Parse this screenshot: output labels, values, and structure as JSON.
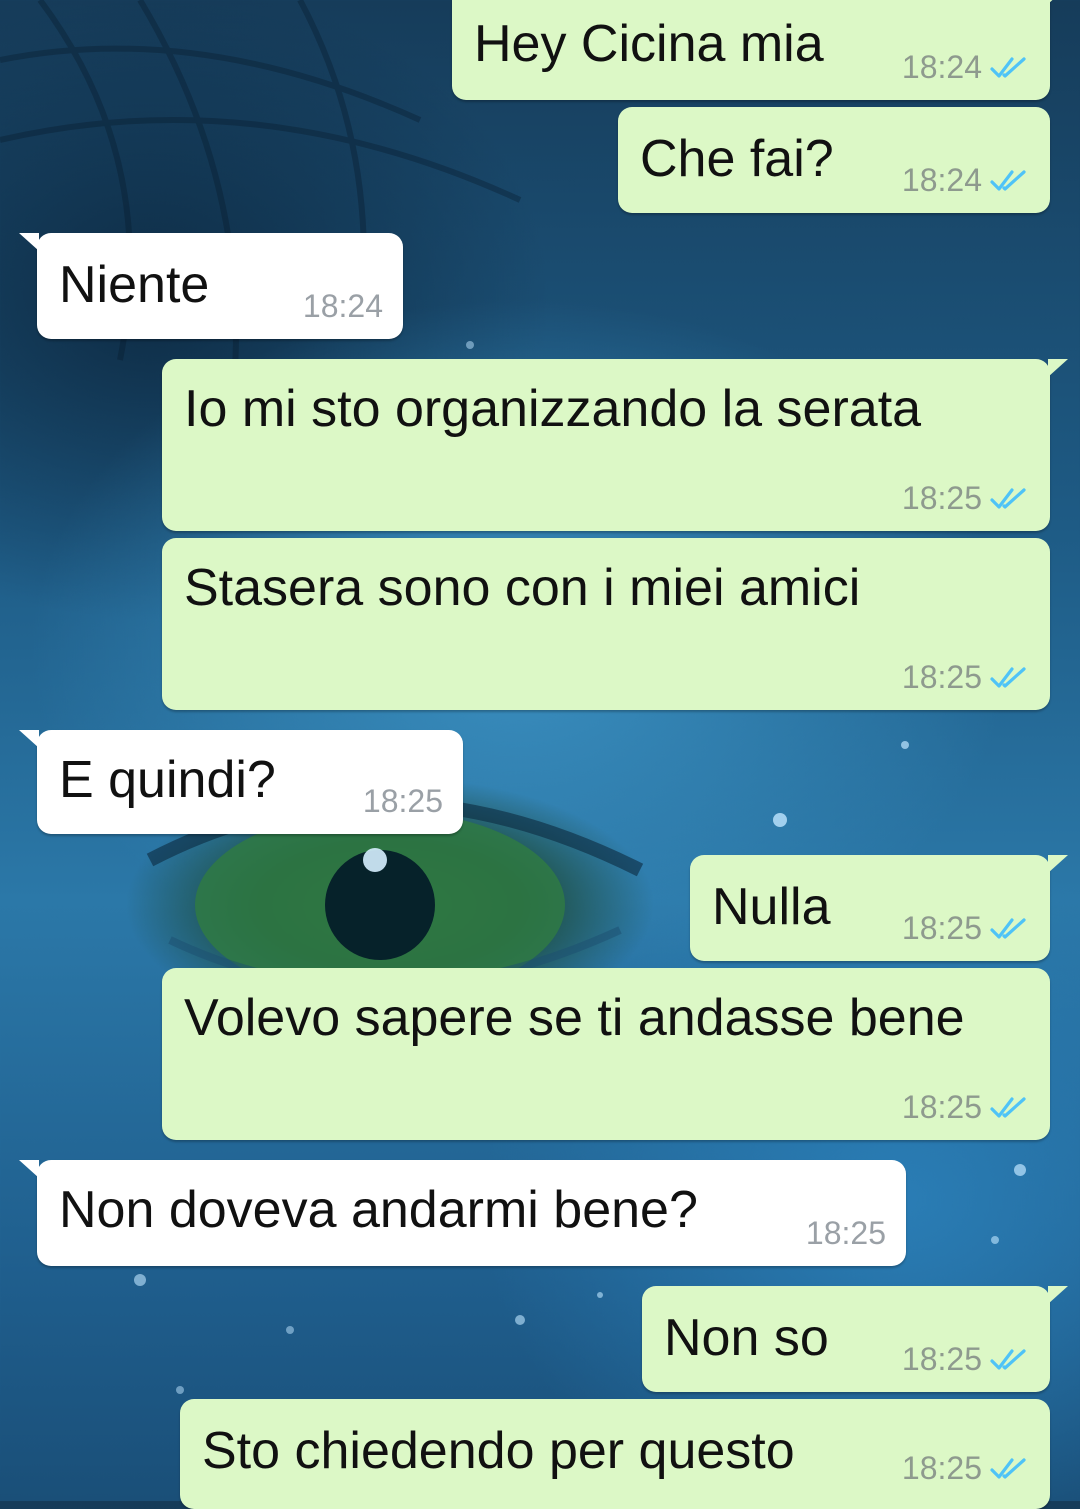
{
  "colors": {
    "outgoing_bubble": "#dcf8c6",
    "incoming_bubble": "#ffffff",
    "read_ticks": "#4fc3f7",
    "timestamp": "#8e9a8e"
  },
  "messages": [
    {
      "direction": "outgoing",
      "text": "Hey Cicina mia",
      "time": "18:24",
      "status": "read"
    },
    {
      "direction": "outgoing",
      "text": "Che fai?",
      "time": "18:24",
      "status": "read"
    },
    {
      "direction": "incoming",
      "text": "Niente",
      "time": "18:24"
    },
    {
      "direction": "outgoing",
      "text": "Io mi sto organizzando la serata",
      "time": "18:25",
      "status": "read"
    },
    {
      "direction": "outgoing",
      "text": "Stasera sono con i miei amici",
      "time": "18:25",
      "status": "read"
    },
    {
      "direction": "incoming",
      "text": "E quindi?",
      "time": "18:25"
    },
    {
      "direction": "outgoing",
      "text": "Nulla",
      "time": "18:25",
      "status": "read"
    },
    {
      "direction": "outgoing",
      "text": "Volevo sapere se ti andasse bene",
      "time": "18:25",
      "status": "read"
    },
    {
      "direction": "incoming",
      "text": "Non doveva andarmi bene?",
      "time": "18:25"
    },
    {
      "direction": "outgoing",
      "text": "Non so",
      "time": "18:25",
      "status": "read"
    },
    {
      "direction": "outgoing",
      "text": "Sto chiedendo per questo",
      "time": "18:25",
      "status": "read"
    }
  ]
}
